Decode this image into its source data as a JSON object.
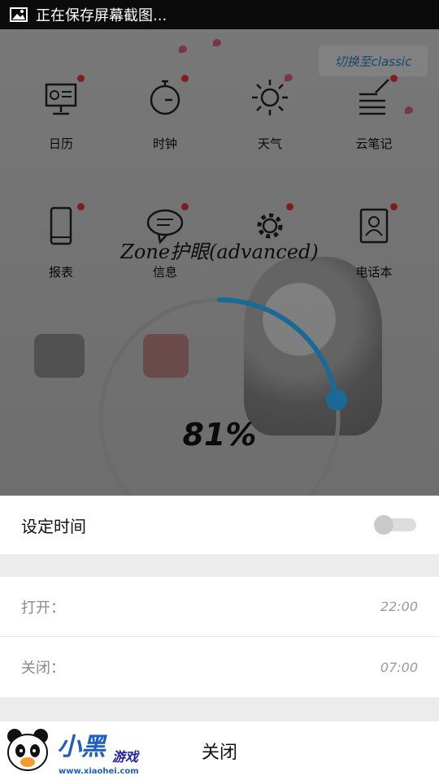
{
  "status_bar": {
    "notification_text": "正在保存屏幕截图...",
    "icon": "image-icon"
  },
  "background": {
    "switch_label": "切换至classic",
    "apps": [
      {
        "label": "日历",
        "icon": "presentation-board-icon"
      },
      {
        "label": "时钟",
        "icon": "stopwatch-icon"
      },
      {
        "label": "天气",
        "icon": "sun-icon"
      },
      {
        "label": "云笔记",
        "icon": "notepad-pen-icon"
      },
      {
        "label": "报表",
        "icon": "phone-icon"
      },
      {
        "label": "信息",
        "icon": "chat-bubble-icon"
      },
      {
        "label": "",
        "icon": "gear-icon"
      },
      {
        "label": "电话本",
        "icon": "contacts-book-icon"
      }
    ]
  },
  "dialog": {
    "title": "Zone护眼(advanced)",
    "percent_label": "81%",
    "percent_value": 0.81,
    "accent_color": "#1a6a97",
    "set_time_label": "设定时间",
    "set_time_enabled": false,
    "open_label": "打开：",
    "open_time": "22:00",
    "close_label": "关闭：",
    "close_time": "07:00",
    "close_button_label": "关闭"
  },
  "watermark": {
    "brand": "小黑",
    "brand_sub": "游戏",
    "url": "www.xiaohei.com"
  }
}
